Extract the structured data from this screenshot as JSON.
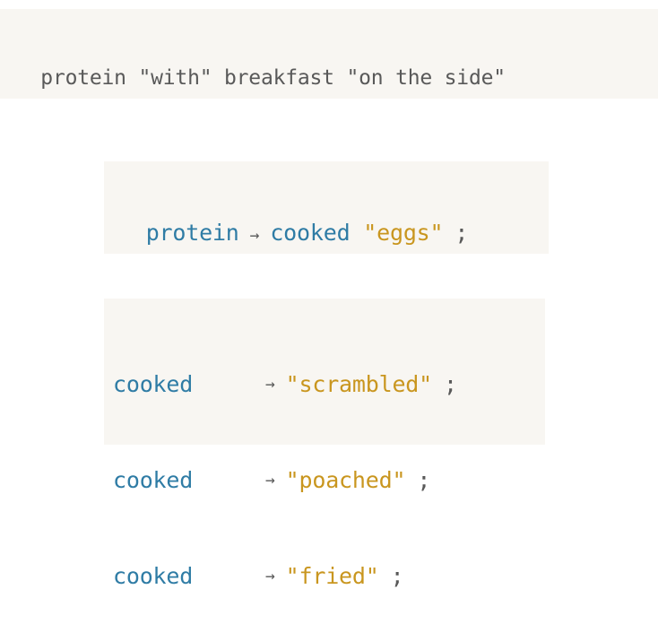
{
  "top_rule": {
    "text": "protein \"with\" breakfast \"on the side\""
  },
  "protein_rule": {
    "lhs": "protein",
    "arrow": "→",
    "nonterminal": "cooked",
    "terminal": "\"eggs\"",
    "end": ";"
  },
  "cooked_rules": [
    {
      "lhs": "cooked",
      "arrow": "→",
      "terminal": "\"scrambled\"",
      "end": ";"
    },
    {
      "lhs": "cooked",
      "arrow": "→",
      "terminal": "\"poached\"",
      "end": ";"
    },
    {
      "lhs": "cooked",
      "arrow": "→",
      "terminal": "\"fried\"",
      "end": ";"
    }
  ],
  "colors": {
    "nonterminal": "#2f7ca5",
    "terminal": "#c9961f",
    "plain": "#595959",
    "code_background": "#f8f6f2"
  }
}
